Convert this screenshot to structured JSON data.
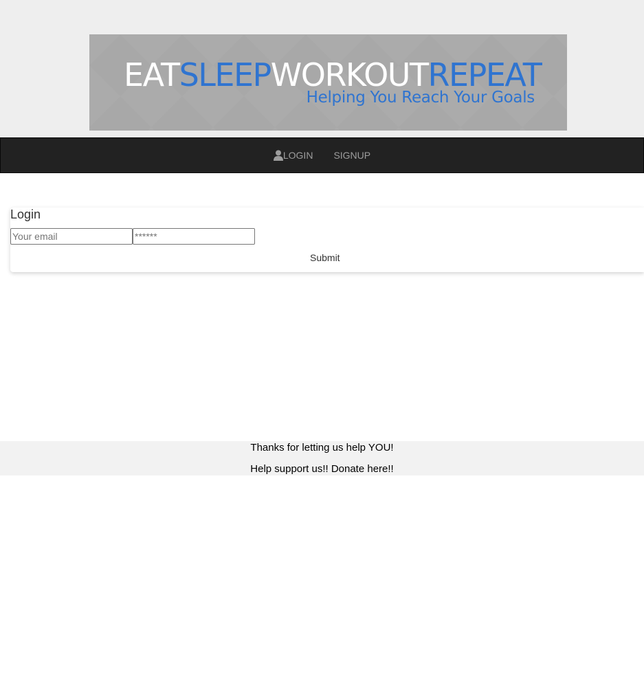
{
  "banner": {
    "title_parts": [
      "EAT",
      "SLEEP",
      "WORKOUT",
      "REPEAT"
    ],
    "subtitle": "Helping You Reach Your Goals",
    "colors": {
      "white_text": "#ffffff",
      "blue_text": "#2f74d0",
      "banner_bg": "#a8a8a8"
    }
  },
  "nav": {
    "login_label": "LOGIN",
    "signup_label": "SIGNUP",
    "login_icon": "user-icon",
    "bg_color": "#222222",
    "text_color": "#9d9d9d"
  },
  "login": {
    "title": "Login",
    "email_placeholder": "Your email",
    "password_placeholder": "******",
    "submit_label": "Submit"
  },
  "footer": {
    "line1": "Thanks for letting us help YOU!",
    "line2": "Help support us!! Donate here!!"
  }
}
